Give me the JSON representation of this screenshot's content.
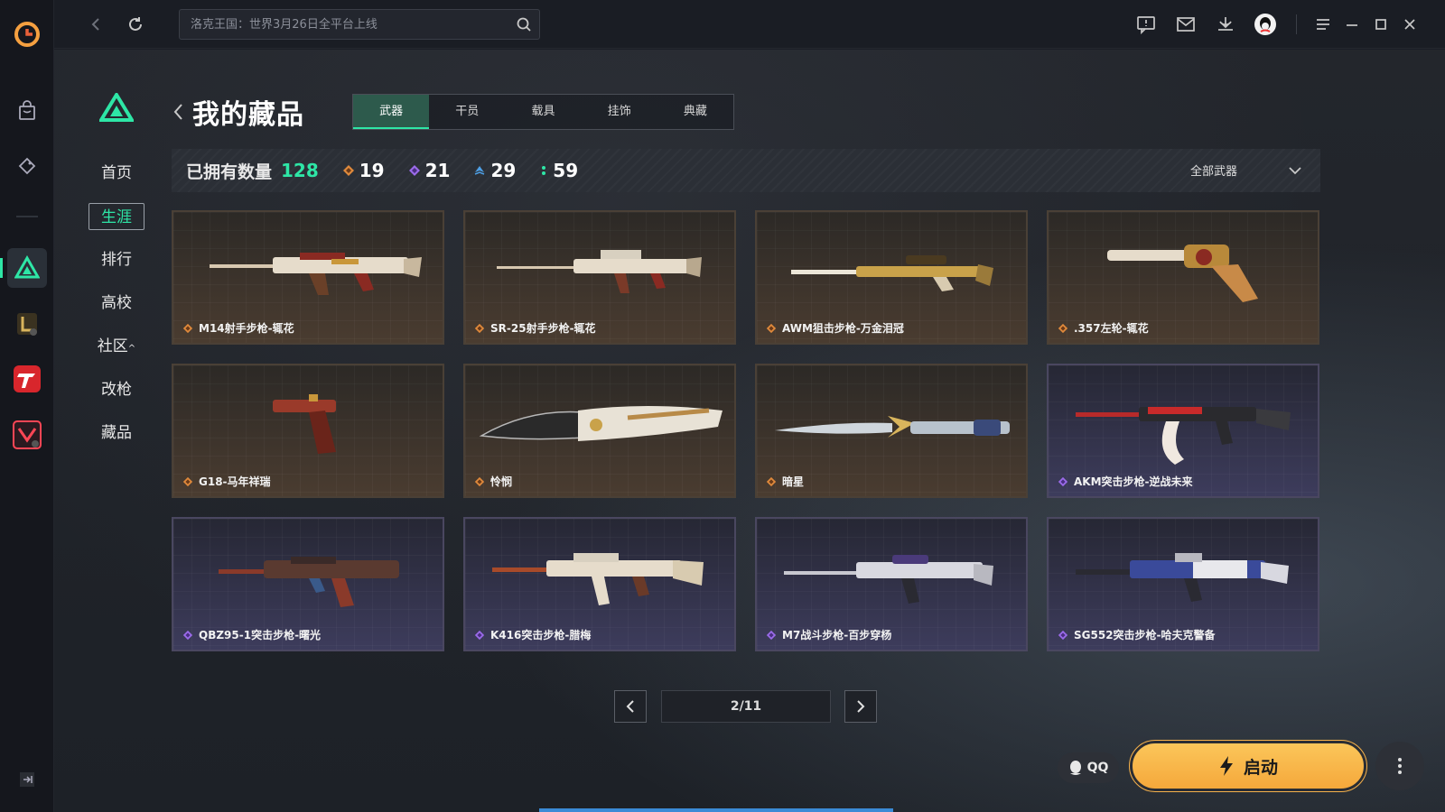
{
  "search": {
    "placeholder": "洛克王国：世界3月26日全平台上线"
  },
  "sidebar": {
    "items": [
      "首页",
      "生涯",
      "排行",
      "高校",
      "社区",
      "改枪",
      "藏品"
    ],
    "active_index": 1,
    "community_caret": "^"
  },
  "page": {
    "title": "我的藏品"
  },
  "tabs": [
    {
      "label": "武器",
      "active": true
    },
    {
      "label": "干员",
      "active": false
    },
    {
      "label": "载具",
      "active": false
    },
    {
      "label": "挂饰",
      "active": false
    },
    {
      "label": "典藏",
      "active": false
    }
  ],
  "stats": {
    "label": "已拥有数量",
    "total": "128",
    "counts": [
      {
        "value": "19",
        "rarity": "gold",
        "color": "#e08a3c"
      },
      {
        "value": "21",
        "rarity": "purple",
        "color": "#9b6bea"
      },
      {
        "value": "29",
        "rarity": "blue",
        "color": "#4ea0e6"
      },
      {
        "value": "59",
        "rarity": "green",
        "color": "#2ee6a6"
      }
    ],
    "filter": "全部武器"
  },
  "items": [
    {
      "name": "M14射手步枪-辄花",
      "rarity": "gold"
    },
    {
      "name": "SR-25射手步枪-辄花",
      "rarity": "gold"
    },
    {
      "name": "AWM狙击步枪-万金泪冠",
      "rarity": "gold"
    },
    {
      "name": ".357左轮-辄花",
      "rarity": "gold"
    },
    {
      "name": "G18-马年祥瑞",
      "rarity": "gold"
    },
    {
      "name": "怜悯",
      "rarity": "gold"
    },
    {
      "name": "暗星",
      "rarity": "gold"
    },
    {
      "name": "AKM突击步枪-逆战未来",
      "rarity": "purple"
    },
    {
      "name": "QBZ95-1突击步枪-曙光",
      "rarity": "purple"
    },
    {
      "name": "K416突击步枪-腊梅",
      "rarity": "purple"
    },
    {
      "name": "M7战斗步枪-百步穿杨",
      "rarity": "purple"
    },
    {
      "name": "SG552突击步枪-哈夫克警备",
      "rarity": "purple"
    }
  ],
  "pagination": {
    "display": "2/11"
  },
  "bottom": {
    "qq_label": "QQ",
    "launch_label": "启动"
  },
  "colors": {
    "accent": "#2ee6a6",
    "launch": "#f7b24b",
    "gold_gem": "#e08a3c",
    "purple_gem": "#9b6bea"
  }
}
